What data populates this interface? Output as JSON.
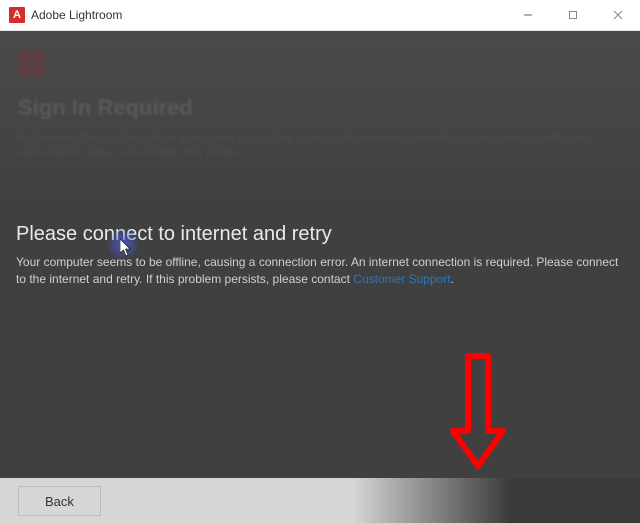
{
  "window": {
    "title": "Adobe Lightroom",
    "controls": {
      "minimize": "–",
      "maximize": "□",
      "close": "×"
    }
  },
  "background_dialog": {
    "title": "Sign In Required",
    "body": "A Creative Cloud subscription is required to use this product. An internet connection is required to verify your subscription status and enable this product."
  },
  "error": {
    "title": "Please connect to internet and retry",
    "body_pre": "Your computer seems to be offline, causing a connection error. An internet connection is required. Please connect to the internet and retry. If this problem persists, please contact ",
    "link_text": "Customer Support",
    "body_post": "."
  },
  "footer": {
    "back_label": "Back"
  }
}
